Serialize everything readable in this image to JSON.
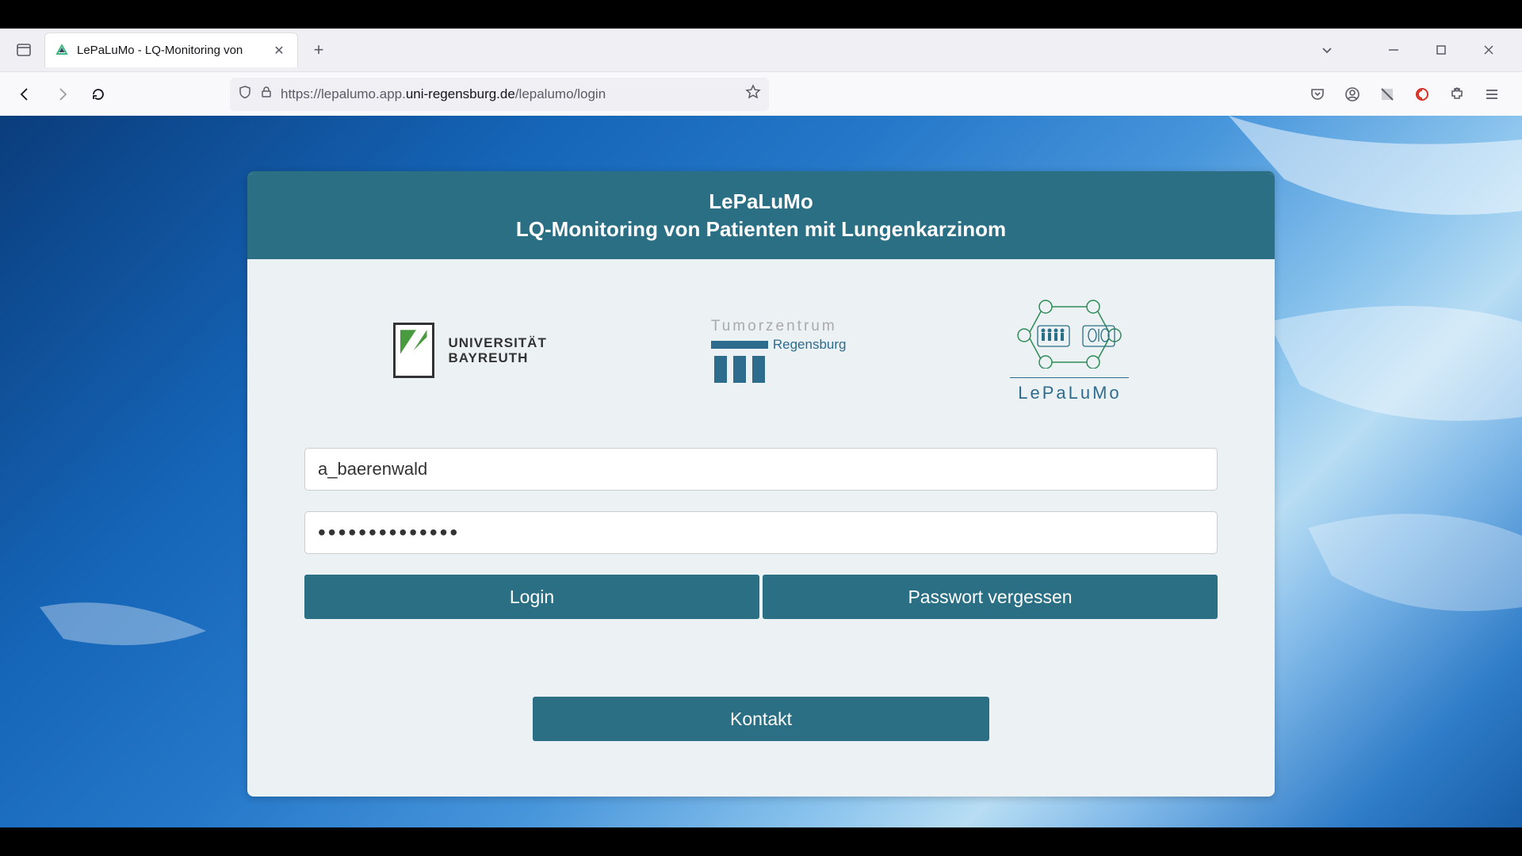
{
  "browser": {
    "tab_title": "LePaLuMo - LQ-Monitoring von",
    "url_prefix": "https://lepalumo.app.",
    "url_domain": "uni-regensburg.de",
    "url_path": "/lepalumo/login"
  },
  "header": {
    "title_line1": "LePaLuMo",
    "title_line2": "LQ-Monitoring von Patienten mit Lungenkarzinom"
  },
  "logos": {
    "uni_bayreuth_line1": "UNIVERSITÄT",
    "uni_bayreuth_line2": "BAYREUTH",
    "tumorzentrum_top": "Tumorzentrum",
    "tumorzentrum_city": "Regensburg",
    "lepalumo": "LePaLuMo"
  },
  "form": {
    "username_value": "a_baerenwald",
    "password_value": "••••••••••••••",
    "login_label": "Login",
    "forgot_label": "Passwort vergessen",
    "contact_label": "Kontakt"
  },
  "colors": {
    "teal": "#2a6f84",
    "card_bg": "#ecf1f4"
  }
}
